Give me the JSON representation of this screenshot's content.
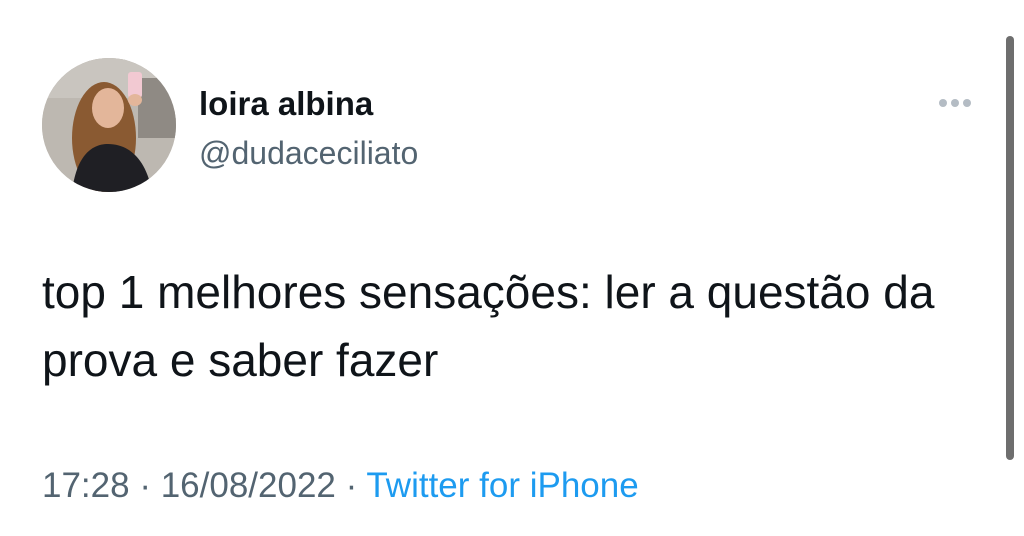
{
  "user": {
    "display_name": "loira albina",
    "handle": "@dudaceciliato",
    "avatar_icon": "profile-photo"
  },
  "menu": {
    "icon": "more-horizontal-icon"
  },
  "tweet": {
    "text": "top 1 melhores sensações: ler a questão da prova e saber fazer"
  },
  "meta": {
    "time": "17:28",
    "date": "16/08/2022",
    "separator": " · ",
    "source": "Twitter for iPhone"
  },
  "colors": {
    "text": "#0f1419",
    "secondary": "#536471",
    "link": "#1d9bf0"
  }
}
